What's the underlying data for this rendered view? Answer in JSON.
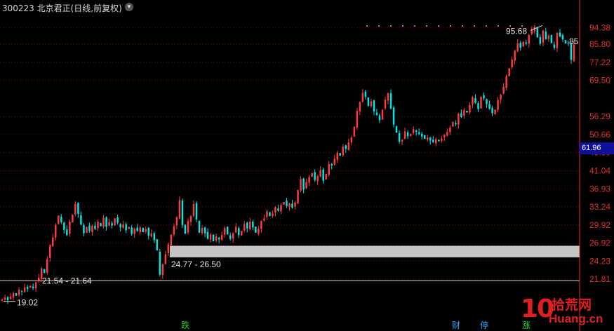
{
  "header": {
    "title": "300223 北京君正(日线,前复权)",
    "current_price_label": "61.96"
  },
  "watermark": {
    "logo": "10",
    "cn": "拾荒网",
    "url": "Huang.cn"
  },
  "colors": {
    "up": "#ff3b3b",
    "down": "#00e5e5",
    "grid": "#8a0000",
    "axis_text": "#e23030",
    "annotation": "#e0e0e0",
    "marker": "#ff44ff",
    "band": "#c4c4c4",
    "current_bg": "#10109a"
  },
  "chart_data": {
    "type": "candlestick",
    "ylim": [
      17.5,
      99
    ],
    "yaxis_ticks": [
      "94.38",
      "85.80",
      "77.22",
      "69.50",
      "56.29",
      "50.66",
      "45.60",
      "41.04",
      "36.93",
      "33.24",
      "29.92",
      "26.92",
      "24.23",
      "21.81"
    ],
    "highlight_band": [
      24.77,
      26.5
    ],
    "annotations": [
      {
        "label": "95.68",
        "value": 95.68,
        "kind": "high"
      },
      {
        "label": "19.02",
        "value": 19.02,
        "kind": "low"
      },
      {
        "label": "21.54 - 21.64",
        "kind": "range_note",
        "value": 21.6
      },
      {
        "label": "24.77 - 26.50",
        "kind": "band_note",
        "value": 24.77
      },
      {
        "label": "85",
        "kind": "last_note",
        "value": 85.8
      }
    ],
    "event_markers": [
      "跌",
      "财",
      "停",
      "涨"
    ],
    "purple_dots": 14,
    "closes": [
      19.4,
      19.6,
      19.3,
      19.7,
      20.1,
      19.8,
      20.5,
      20.3,
      20.8,
      20.6,
      21.0,
      20.7,
      21.4,
      22.0,
      23.2,
      22.6,
      24.5,
      26.6,
      27.8,
      29.9,
      31.6,
      30.4,
      29.1,
      28.2,
      30.5,
      31.8,
      33.8,
      31.9,
      30.0,
      28.5,
      29.6,
      28.9,
      29.8,
      29.2,
      30.5,
      29.7,
      31.2,
      29.6,
      30.4,
      29.8,
      31.1,
      30.3,
      29.5,
      30.0,
      29.0,
      29.6,
      28.4,
      29.3,
      28.9,
      29.5,
      28.7,
      29.2,
      28.1,
      28.5,
      27.4,
      25.8,
      22.4,
      23.8,
      25.2,
      26.7,
      28.3,
      29.7,
      31.3,
      34.6,
      29.9,
      28.4,
      30.6,
      31.5,
      33.8,
      30.9,
      28.6,
      29.4,
      28.5,
      27.6,
      28.3,
      27.2,
      28.0,
      27.5,
      28.2,
      29.4,
      28.3,
      27.6,
      28.5,
      29.6,
      28.2,
      28.9,
      30.1,
      29.3,
      30.5,
      29.5,
      28.6,
      29.3,
      30.6,
      31.1,
      32.4,
      31.5,
      32.0,
      33.2,
      32.5,
      33.6,
      34.2,
      33.4,
      33.9,
      33.1,
      34.1,
      36.7,
      39.1,
      36.8,
      38.4,
      39.6,
      40.5,
      38.9,
      39.8,
      41.2,
      38.7,
      40.3,
      42.7,
      42.3,
      44.0,
      45.6,
      44.8,
      47.2,
      46.6,
      48.4,
      49.8,
      53.1,
      58.2,
      61.2,
      64.6,
      63.2,
      59.8,
      61.5,
      58.0,
      56.8,
      55.1,
      58.6,
      62.1,
      64.5,
      59.0,
      53.7,
      51.2,
      48.6,
      49.1,
      51.6,
      50.2,
      50.9,
      52.3,
      51.5,
      50.8,
      50.1,
      49.4,
      49.8,
      48.9,
      48.5,
      49.3,
      48.7,
      49.5,
      50.6,
      51.4,
      52.8,
      54.6,
      53.8,
      57.2,
      56.1,
      58.5,
      57.6,
      60.2,
      63.1,
      61.0,
      58.8,
      63.2,
      62.5,
      60.5,
      58.9,
      57.4,
      58.6,
      61.9,
      63.9,
      66.9,
      71.2,
      74.6,
      78.5,
      82.6,
      86.3,
      84.0,
      87.1,
      86.1,
      90.5,
      93.2,
      95.0,
      89.2,
      86.0,
      92.8,
      88.4,
      90.1,
      86.3,
      84.0,
      91.6,
      89.8,
      88.3,
      86.1,
      85.8,
      78.3,
      85.6
    ]
  }
}
